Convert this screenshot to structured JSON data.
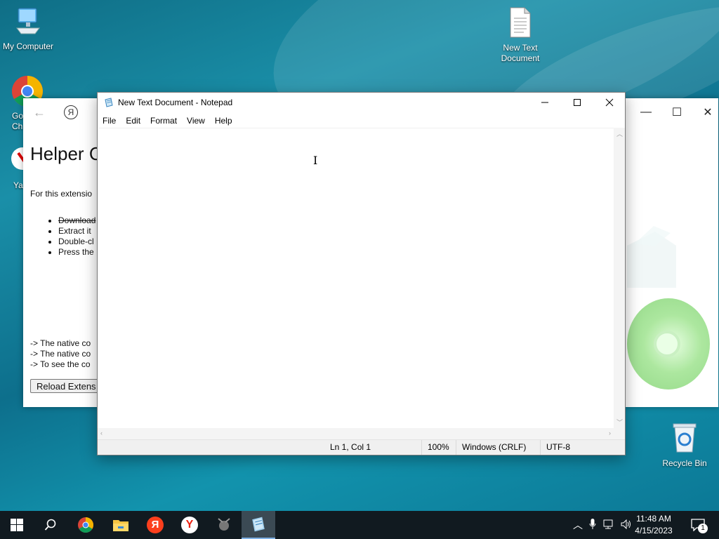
{
  "desktop": {
    "icons": [
      {
        "label": "My Computer"
      },
      {
        "label": "Go\nCh"
      },
      {
        "label": "Ya"
      },
      {
        "label": "New Text Document"
      },
      {
        "label": "Recycle Bin"
      }
    ]
  },
  "browser": {
    "heading": "Helper C",
    "para": "For this extensio",
    "bullets": [
      "Download",
      "Extract it",
      "Double-cl",
      "Press the"
    ],
    "notes": [
      "-> The native co",
      "-> The native co",
      "-> To see the co"
    ],
    "reload_label": "Reload Extens",
    "yandex_glyph": "Я"
  },
  "notepad": {
    "title": "New Text Document - Notepad",
    "menu": [
      "File",
      "Edit",
      "Format",
      "View",
      "Help"
    ],
    "content": "",
    "status": {
      "position": "Ln 1, Col 1",
      "zoom": "100%",
      "line_endings": "Windows (CRLF)",
      "encoding": "UTF-8"
    }
  },
  "taskbar": {
    "apps": [
      "start-icon",
      "search-icon",
      "chrome-icon",
      "file-explorer-icon",
      "yandex-icon",
      "yandex-browser-icon",
      "app-icon",
      "notepad-icon"
    ],
    "clock_time": "11:48 AM",
    "clock_date": "4/15/2023",
    "notification_count": "1"
  },
  "colors": {
    "desktop_bg": "#0f6e86",
    "taskbar_bg": "#111a20",
    "active_task": "#3b4a54"
  }
}
